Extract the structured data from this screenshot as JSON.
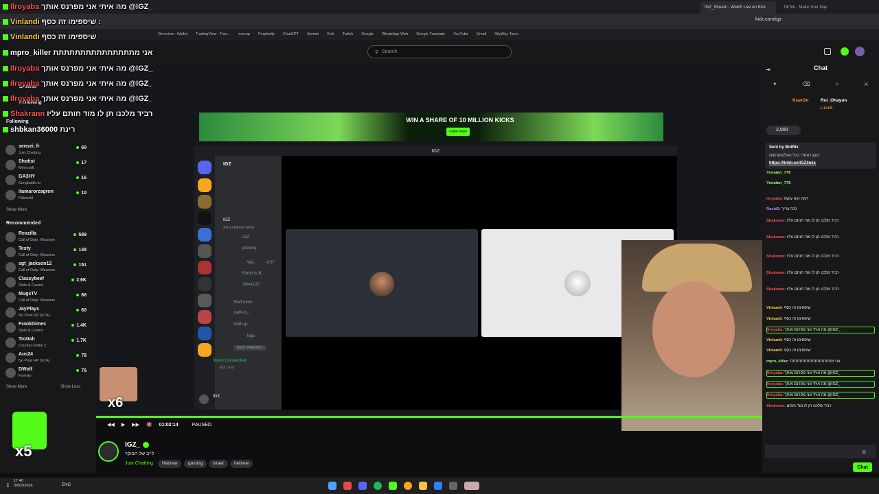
{
  "browser": {
    "tabs": [
      {
        "label": "IGZ_Stream - Watch Live on Kick"
      },
      {
        "label": "TikTok - Make Your Day"
      }
    ],
    "url": "kick.com/igz",
    "bookmarks": [
      "Overview - Wallet",
      "TradingView - Trac...",
      "mexup",
      "Perplexity",
      "ChatGPT",
      "Gemini",
      "Kick",
      "Twitch",
      "Google",
      "WhatsApp Web",
      "Google Translate",
      "YouTube",
      "Gmail",
      "SkyWay Tours"
    ]
  },
  "kick": {
    "search_placeholder": "Search"
  },
  "alerts": [
    {
      "user": "Ilroyaba",
      "text": "מה איתי אני מפרנס אותך @IGZ_",
      "color": "#ff4d4d"
    },
    {
      "user": "Vinlandi",
      "text": "שיספימו זה כסף :",
      "color": "#ffd23f"
    },
    {
      "user": "Vinlandi",
      "text": "שיספימו זה כסף",
      "color": "#ffd23f"
    },
    {
      "user": "mpro_killer",
      "text": "אני מתתתתתתתתתתתתתתת",
      "color": "#fff"
    },
    {
      "user": "Ilroyaba",
      "text": "מה איתי אני מפרנס אותך @IGZ_",
      "color": "#ff4d4d"
    },
    {
      "user": "Ilroyaba",
      "text": "מה איתי אני מפרנס אותך @IGZ_",
      "color": "#ff4d4d"
    },
    {
      "user": "Ilroyaba",
      "text": "מה איתי אני מפרנס אותך @IGZ_",
      "color": "#ff4d4d"
    },
    {
      "user": "Shakrann",
      "text": "רביד מלכנו תן לו מוד חותם עליו",
      "color": "#ff4d4d"
    },
    {
      "user": "shbkan36000",
      "text": "רינת",
      "color": "#fff"
    }
  ],
  "sidebar": {
    "browse_label": "Browse",
    "following_label": "Following",
    "following": [
      {
        "name": "sensei_fr",
        "game": "Just Chatting",
        "viewers": "60"
      },
      {
        "name": "Shotist",
        "game": "Minecraft",
        "viewers": "17"
      },
      {
        "name": "GA3HY",
        "game": "Songbattle.io",
        "viewers": "16"
      },
      {
        "name": "itamarorzagron",
        "game": "Palworld",
        "viewers": "10"
      }
    ],
    "show_more": "Show More",
    "recommended_label": "Recommended",
    "recommended": [
      {
        "name": "Rexzilla",
        "game": "Call of Duty: Warzone",
        "viewers": "589"
      },
      {
        "name": "Testy",
        "game": "Call of Duty: Warzone",
        "viewers": "138"
      },
      {
        "name": "sgt_jackson12",
        "game": "Call of Duty: Warzone",
        "viewers": "151"
      },
      {
        "name": "Classybeef",
        "game": "Slots & Casino",
        "viewers": "2.6K"
      },
      {
        "name": "MugsTV",
        "game": "Call of Duty: Warzone",
        "viewers": "66"
      },
      {
        "name": "JayPlays",
        "game": "No Pixel RP (GTA)",
        "viewers": "60"
      },
      {
        "name": "FrankDimes",
        "game": "Slots & Casino",
        "viewers": "1.4K"
      },
      {
        "name": "Trottah",
        "game": "Counter-Strike 2",
        "viewers": "1.7K"
      },
      {
        "name": "Aus24",
        "game": "No Pixel RP (GTA)",
        "viewers": "78"
      },
      {
        "name": "DWolf",
        "game": "Fortnite",
        "viewers": "76"
      }
    ],
    "show_more2": "Show More",
    "show_less": "Show Less"
  },
  "banner": {
    "text": "WIN A SHARE OF 10 MILLION KICKS",
    "button": "Learn more"
  },
  "discord": {
    "title": "IGZ",
    "server": "IGZ",
    "channels": [
      "IGZ",
      "Set a channel status",
      "IGZ",
      "proking",
      "Wa...",
      "Fafnir Is B...",
      "Vibex122",
      "Staff room",
      "staff-co...",
      "staff-up...",
      "logs",
      "NEW UNREADS"
    ],
    "voice_connected": "Voice Connected",
    "voice_sub": "IGZ / IGZ",
    "user": "IGZ",
    "timer": "4:27"
  },
  "player": {
    "time": "01:02:14",
    "state": "PAUSED"
  },
  "stream": {
    "name": "IGZ_",
    "title": "לייב של הבוקר",
    "category": "Just Chatting",
    "tags": [
      "Hebrew",
      "gaming",
      "israel",
      "hebrew"
    ]
  },
  "chat": {
    "title": "Chat",
    "top_gifters": [
      {
        "name": "KravOn"
      },
      {
        "name": "Roi_Ohayon"
      },
      {
        "name": "L1orB"
      }
    ],
    "gift_count": "2,000",
    "pinned_by": "Sent by BotRix",
    "pinned_text": "עקבו אחרי בכל הפלטפורמות:",
    "pinned_link": "https://linktr.ee/IGZlinks",
    "messages": [
      {
        "user": "Yonatan_778",
        "text": "",
        "hl": false
      },
      {
        "user": "Yonatan_778",
        "text": "",
        "hl": false
      },
      {
        "user": "Ilroyaba",
        "text": "מה הוא עושה?",
        "hl": false
      },
      {
        "user": "Ravid2",
        "text": "ככה צריך",
        "hl": false
      },
      {
        "user": "Shakrann",
        "text": "רביד מלכנו תן לו מוד חותם עליו",
        "hl": false
      },
      {
        "user": "Shakrann",
        "text": "רביד מלכנו תן לו מוד חותם עליו",
        "hl": false
      },
      {
        "user": "Shakrann",
        "text": "רביד מלכנו תן לו מוד חותם עליו",
        "hl": false
      },
      {
        "user": "Shakrann",
        "text": "רביד מלכנו תן לו מוד חותם עליו",
        "hl": false
      },
      {
        "user": "Shakrann",
        "text": "רביד מלכנו תן לו מוד חותם עליו",
        "hl": false
      },
      {
        "user": "Vinlandi",
        "text": "שיספימו זה כסף",
        "hl": false
      },
      {
        "user": "Vinlandi",
        "text": "שיספימו זה כסף",
        "hl": false
      },
      {
        "user": "Ilroyaba",
        "text": "מה איתי אני מפרנס אותך @IGZ_",
        "hl": true
      },
      {
        "user": "Vinlandi",
        "text": "שיספימו זה כסף",
        "hl": false
      },
      {
        "user": "Vinlandi",
        "text": "שיספימו זה כסף",
        "hl": false
      },
      {
        "user": "mpro_killer",
        "text": "אני מתתתתתתתתתתתתתתת",
        "hl": false
      },
      {
        "user": "Ilroyaba",
        "text": "מה איתי אני מפרנס אותך @IGZ_",
        "hl": true
      },
      {
        "user": "Ilroyaba",
        "text": "מה איתי אני מפרנס אותך @IGZ_",
        "hl": true
      },
      {
        "user": "Ilroyaba",
        "text": "מה איתי אני מפרנס אותך @IGZ_",
        "hl": true
      },
      {
        "user": "Shakrann",
        "text": "רביד מלכנו תן לו מוד חותם",
        "hl": false
      }
    ],
    "send_label": "Chat"
  },
  "emotes": {
    "count1": "x6",
    "count2": "x5"
  },
  "taskbar": {
    "time": "17:40",
    "date": "30/03/2026",
    "lang": "ENG"
  },
  "colors": {
    "kick_green": "#53fc18",
    "bg": "#0e0e10",
    "panel": "#18181b"
  }
}
